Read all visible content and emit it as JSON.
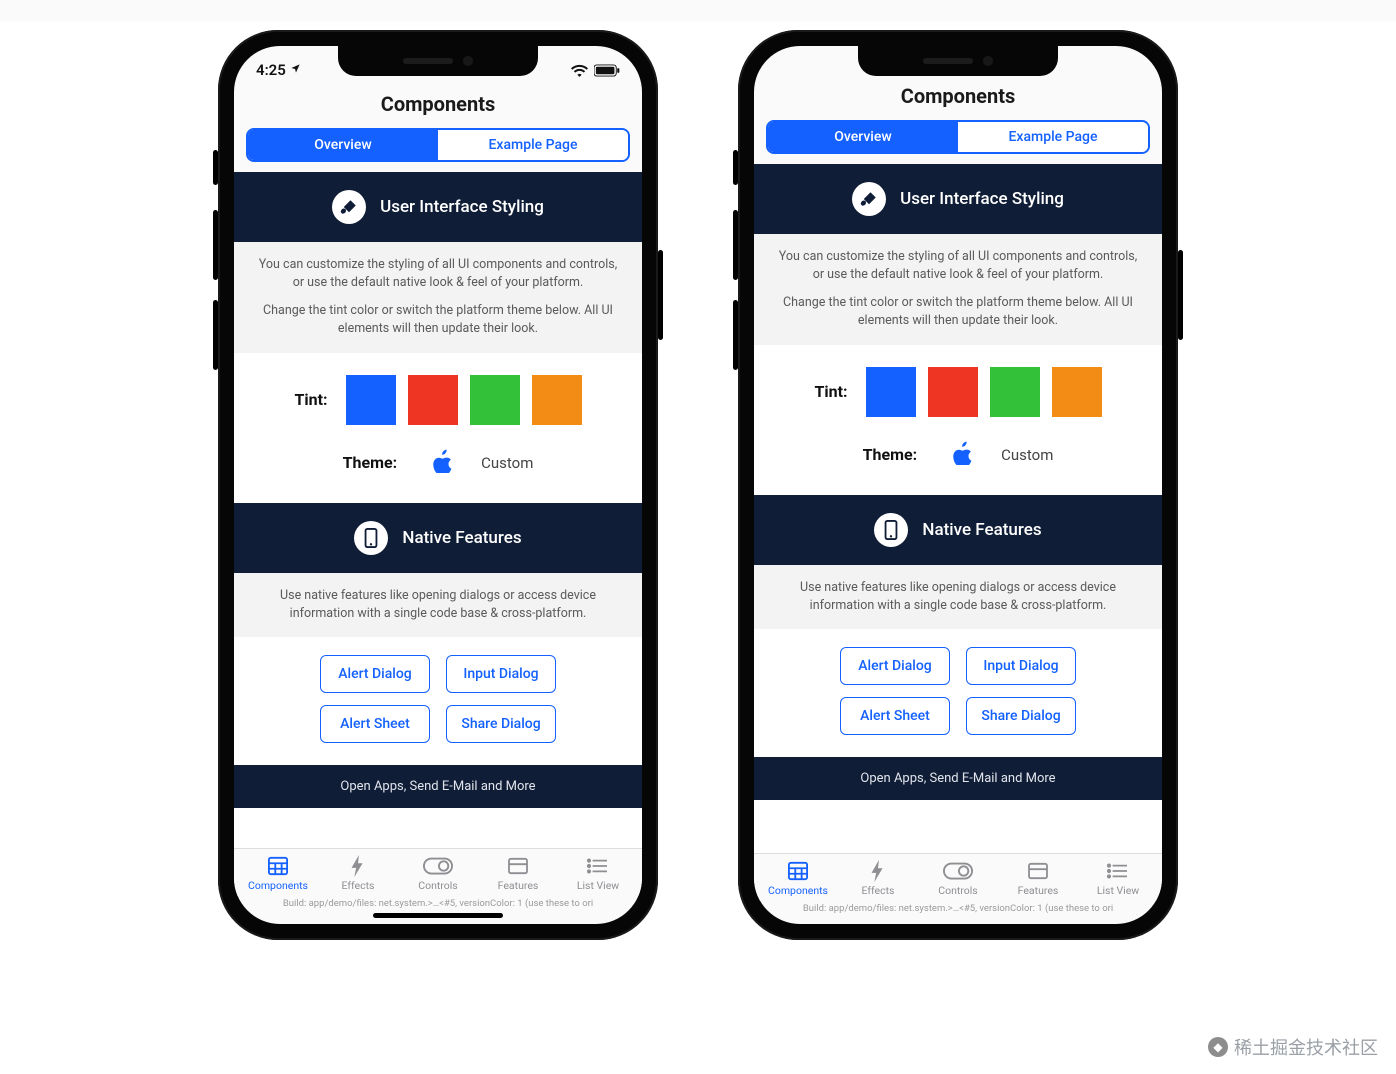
{
  "colors": {
    "accent": "#1461ff",
    "darkHeader": "#101d36",
    "tints": [
      "#1461ff",
      "#ee3524",
      "#34c13a",
      "#f28c14"
    ]
  },
  "statusBar": {
    "time": "4:25",
    "locationArrow": true
  },
  "header": {
    "title": "Components"
  },
  "segmented": {
    "active": "Overview",
    "tabs": [
      "Overview",
      "Example Page"
    ]
  },
  "section1": {
    "icon": "brush-icon",
    "title": "User Interface Styling",
    "descLine1": "You can customize the styling of all UI components and controls, or use the default native look & feel of your platform.",
    "descLine2": "Change the tint color or switch the platform theme below. All UI elements will then update their look.",
    "tintLabel": "Tint:",
    "themeLabel": "Theme:",
    "themeOptionA_icon": "apple-icon",
    "themeOptionB": "Custom"
  },
  "section2": {
    "icon": "phone-icon",
    "title": "Native Features",
    "desc": "Use native features like opening dialogs or access device information with a single code base & cross-platform.",
    "buttons": [
      "Alert Dialog",
      "Input Dialog",
      "Alert Sheet",
      "Share Dialog"
    ],
    "subFooter": "Open Apps, Send E-Mail and More"
  },
  "tabbar": {
    "items": [
      {
        "label": "Components",
        "icon": "grid-icon",
        "active": true
      },
      {
        "label": "Effects",
        "icon": "bolt-icon",
        "active": false
      },
      {
        "label": "Controls",
        "icon": "toggle-icon",
        "active": false
      },
      {
        "label": "Features",
        "icon": "card-icon",
        "active": false
      },
      {
        "label": "List View",
        "icon": "list-icon",
        "active": false
      }
    ]
  },
  "tinyFooter": "Build: app/demo/files: net.system.>…<#5, versionColor: 1 (use these to ori",
  "watermark": "稀土掘金技术社区"
}
